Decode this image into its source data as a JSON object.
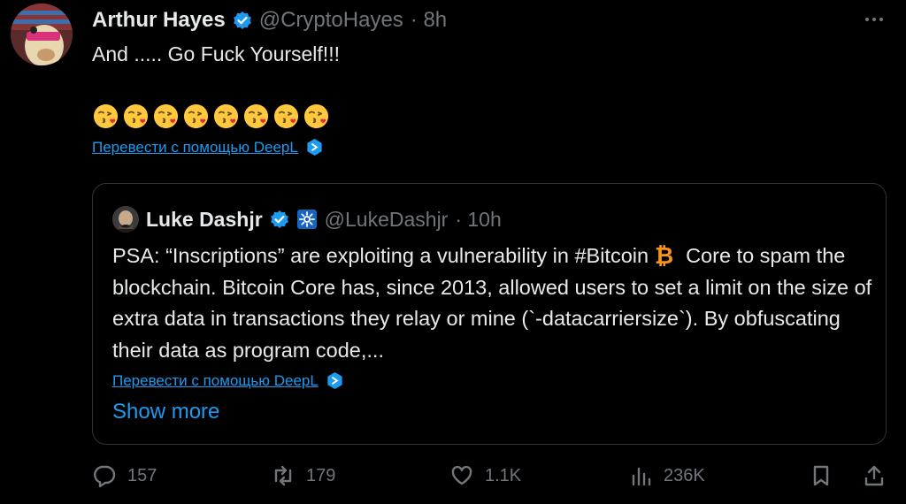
{
  "tweet": {
    "author_name": "Arthur Hayes",
    "author_handle": "@CryptoHayes",
    "time": "· 8h",
    "text": "And ..... Go Fuck Yourself!!!",
    "emoji_count": 8,
    "translate_label": "Перевести с помощью DeepL"
  },
  "quote": {
    "author_name": "Luke Dashjr",
    "author_handle": "@LukeDashjr",
    "time": "· 10h",
    "text_before_hashtag": "PSA: “Inscriptions” are exploiting a vulnerability in ",
    "hashtag": "#Bitcoin",
    "text_after_hashtag": "Core to spam the blockchain. Bitcoin Core has, since 2013, allowed users to set a limit on the size of extra data in transactions they relay or mine (`-datacarriersize`). By obfuscating their data as program code,...",
    "translate_label": "Перевести с помощью DeepL",
    "show_more": "Show more"
  },
  "actions": {
    "replies": "157",
    "reposts": "179",
    "likes": "1.1K",
    "views": "236K"
  },
  "colors": {
    "accent": "#1d9bf0",
    "muted": "#71767b",
    "text": "#e7e9ea",
    "border": "#2f3336",
    "verified": "#1d9bf0"
  },
  "icons": [
    "verified-badge-icon",
    "more-icon",
    "kissing-face-emoji",
    "deepl-icon",
    "gear-badge-icon",
    "bitcoin-icon",
    "reply-icon",
    "repost-icon",
    "like-icon",
    "views-icon",
    "bookmark-icon",
    "share-icon"
  ]
}
